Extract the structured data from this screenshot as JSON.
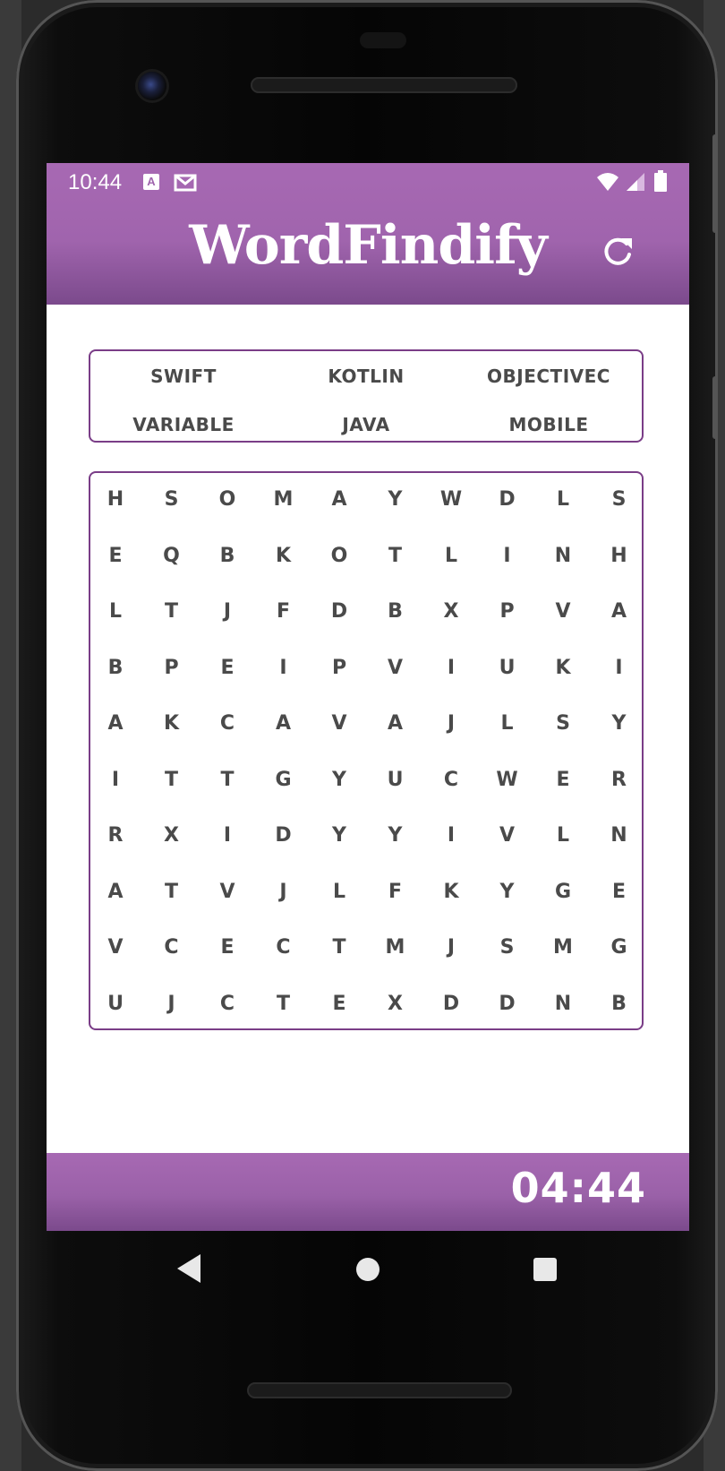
{
  "status_bar": {
    "time": "10:44",
    "icons": [
      "notification-a-icon",
      "mail-icon",
      "wifi-icon",
      "signal-icon",
      "battery-icon"
    ]
  },
  "app": {
    "title": "WordFindify",
    "refresh_icon": "refresh-icon",
    "accent_color": "#a064ad",
    "border_color": "#7a3d87",
    "text_color": "#4a4a4a"
  },
  "words": [
    "SWIFT",
    "KOTLIN",
    "OBJECTIVEC",
    "VARIABLE",
    "JAVA",
    "MOBILE"
  ],
  "grid": [
    [
      "H",
      "S",
      "O",
      "M",
      "A",
      "Y",
      "W",
      "D",
      "L",
      "S"
    ],
    [
      "E",
      "Q",
      "B",
      "K",
      "O",
      "T",
      "L",
      "I",
      "N",
      "H"
    ],
    [
      "L",
      "T",
      "J",
      "F",
      "D",
      "B",
      "X",
      "P",
      "V",
      "A"
    ],
    [
      "B",
      "P",
      "E",
      "I",
      "P",
      "V",
      "I",
      "U",
      "K",
      "I"
    ],
    [
      "A",
      "K",
      "C",
      "A",
      "V",
      "A",
      "J",
      "L",
      "S",
      "Y"
    ],
    [
      "I",
      "T",
      "T",
      "G",
      "Y",
      "U",
      "C",
      "W",
      "E",
      "R"
    ],
    [
      "R",
      "X",
      "I",
      "D",
      "Y",
      "Y",
      "I",
      "V",
      "L",
      "N"
    ],
    [
      "A",
      "T",
      "V",
      "J",
      "L",
      "F",
      "K",
      "Y",
      "G",
      "E"
    ],
    [
      "V",
      "C",
      "E",
      "C",
      "T",
      "M",
      "J",
      "S",
      "M",
      "G"
    ],
    [
      "U",
      "J",
      "C",
      "T",
      "E",
      "X",
      "D",
      "D",
      "N",
      "B"
    ]
  ],
  "timer": "04:44",
  "nav": {
    "back_icon": "back-triangle-icon",
    "home_icon": "home-circle-icon",
    "recents_icon": "recents-square-icon"
  }
}
